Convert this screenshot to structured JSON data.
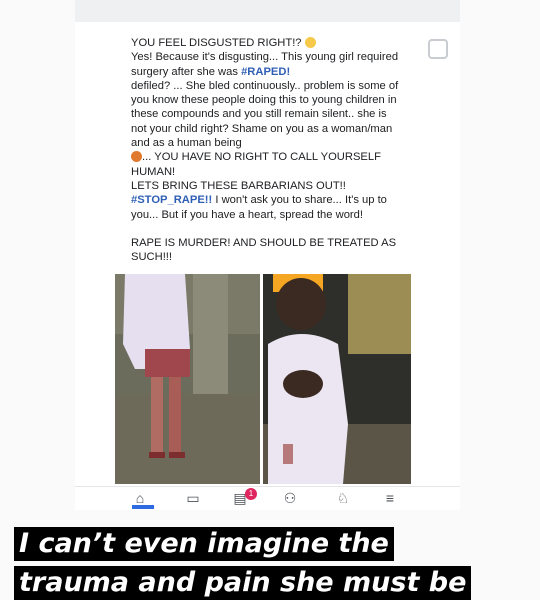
{
  "post": {
    "lines": [
      "YOU FEEL DISGUSTED RIGHT!?",
      "Yes! Because it's disgusting... This young girl required surgery after she was",
      "#RAPED!",
      "defiled? ... She bled continuously.. problem is some of you know these people doing this to young children in these compounds and you still remain silent.. she is not your child right? Shame on you as a woman/man and as a human being",
      "... YOU HAVE NO RIGHT TO CALL YOURSELF HUMAN!",
      "LETS BRING THESE BARBARIANS OUT!!",
      "#STOP_RAPE!!",
      "I won't ask you to share... It's up to you... But if you have a heart, spread the word!",
      "RAPE IS MURDER! AND SHOULD BE TREATED AS SUCH!!!"
    ]
  },
  "nav": {
    "badge_count": "1",
    "icons": [
      "home-icon",
      "video-icon",
      "notifications-icon",
      "groups-icon",
      "bell-icon",
      "menu-icon"
    ]
  },
  "caption": {
    "line1": "I can’t even imagine the",
    "line2": "trauma and pain she must be"
  }
}
